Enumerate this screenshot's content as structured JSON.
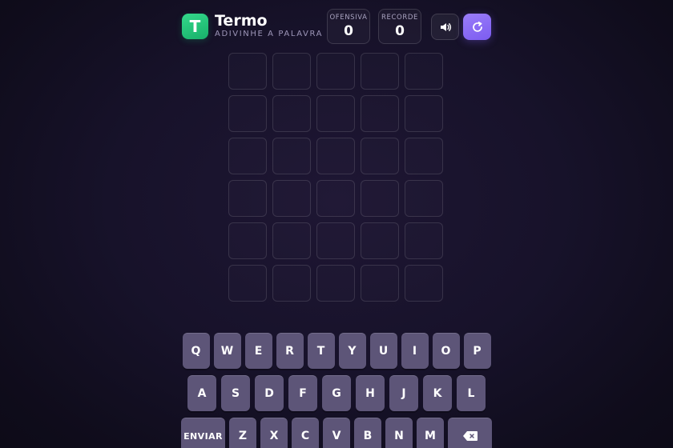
{
  "header": {
    "logo_letter": "T",
    "title": "Termo",
    "subtitle": "ADIVINHE A PALAVRA",
    "streak": {
      "label": "OFENSIVA",
      "value": "0"
    },
    "record": {
      "label": "RECORDE",
      "value": "0"
    },
    "sound_icon": "speaker-icon",
    "reset_icon": "refresh-icon"
  },
  "board": {
    "rows": [
      [
        "",
        "",
        "",
        "",
        ""
      ],
      [
        "",
        "",
        "",
        "",
        ""
      ],
      [
        "",
        "",
        "",
        "",
        ""
      ],
      [
        "",
        "",
        "",
        "",
        ""
      ],
      [
        "",
        "",
        "",
        "",
        ""
      ],
      [
        "",
        "",
        "",
        "",
        ""
      ]
    ]
  },
  "keyboard": {
    "row1": [
      "Q",
      "W",
      "E",
      "R",
      "T",
      "Y",
      "U",
      "I",
      "O",
      "P"
    ],
    "row2": [
      "A",
      "S",
      "D",
      "F",
      "G",
      "H",
      "J",
      "K",
      "L"
    ],
    "row3": [
      "ENVIAR",
      "Z",
      "X",
      "C",
      "V",
      "B",
      "N",
      "M",
      "⌫"
    ]
  },
  "colors": {
    "accent": "#7c5cf0",
    "logo": "#22c47a",
    "key": "#5d5578",
    "background": "#17122a"
  }
}
